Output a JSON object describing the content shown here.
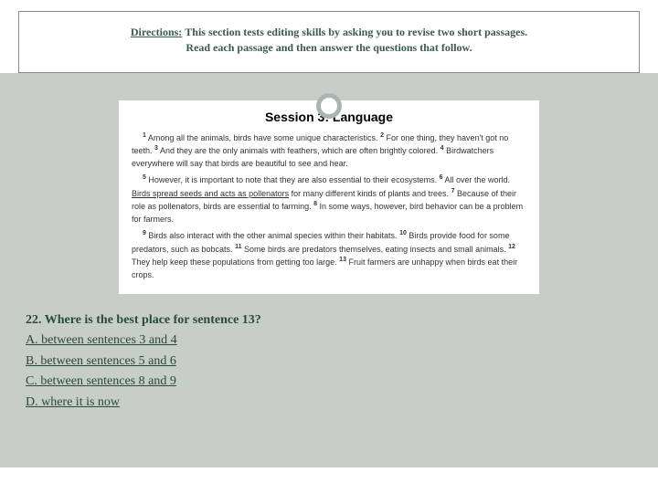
{
  "directions": {
    "label": "Directions:",
    "text1": "This section tests editing skills by asking you to revise two short passages.",
    "text2": "Read each passage and then answer the questions that follow."
  },
  "passage": {
    "session_title": "Session 3: Language",
    "p1_s1": "Among all the animals, birds have some unique characteristics.",
    "p1_s2": "For one thing, they haven't got no teeth.",
    "p1_s3": "And they are the only animals with feathers, which are often brightly colored.",
    "p1_s4": "Birdwatchers everywhere will say that birds are beautiful to see and hear.",
    "p2_s5": "However, it is important to note that they are also essential to their ecosystems.",
    "p2_s6a": "All over the world.",
    "p2_s6b": "Birds spread seeds and acts as pollenators",
    "p2_s6c": "for many different kinds of plants and trees.",
    "p2_s7": "Because of their role as pollenators, birds are essential to farming.",
    "p2_s8": "In some ways, however, bird behavior can be a problem for farmers.",
    "p3_s9": "Birds also interact with the other animal species within their habitats.",
    "p3_s10": "Birds provide food for some predators, such as bobcats.",
    "p3_s11": "Some birds are predators themselves, eating insects and small animals.",
    "p3_s12": "They help keep these populations from getting too large.",
    "p3_s13": "Fruit farmers are unhappy when birds eat their crops."
  },
  "question": {
    "number_text": "22. Where is the best place for sentence 13?",
    "choice_a": "A. between sentences 3 and 4",
    "choice_b": "B. between sentences 5 and 6",
    "choice_c": "C. between sentences 8 and 9",
    "choice_d": "D. where it is now"
  }
}
